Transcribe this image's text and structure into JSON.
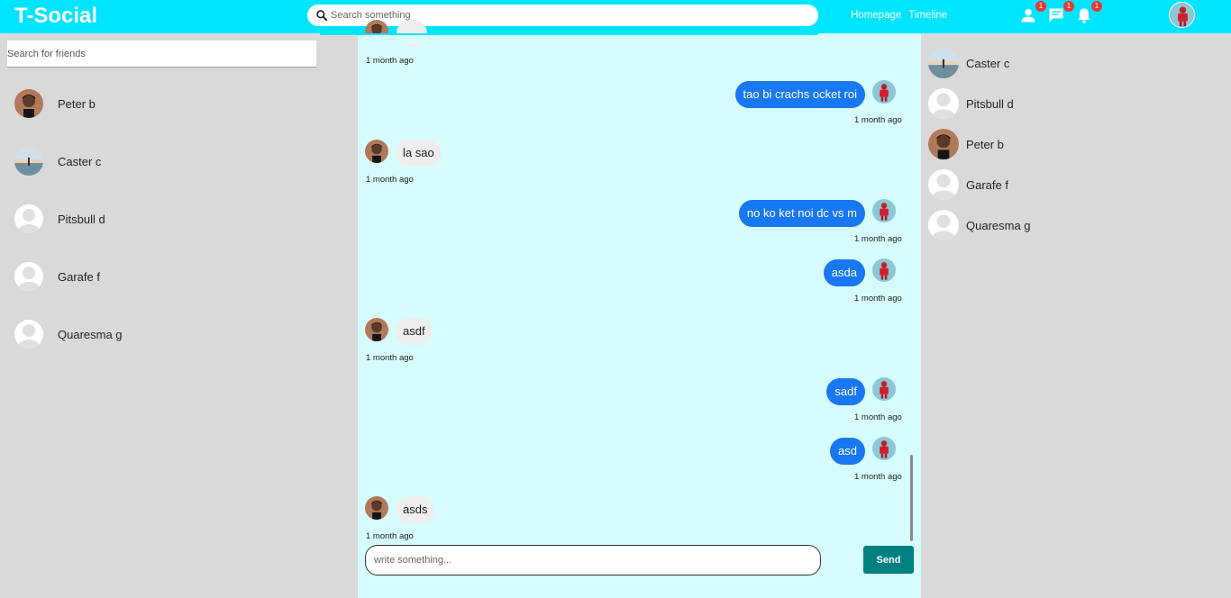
{
  "app": {
    "title": "T-Social"
  },
  "search": {
    "placeholder": "Search something"
  },
  "nav": {
    "homepage": "Homepage",
    "timeline": "Timeline"
  },
  "notifications": {
    "friends": "1",
    "messages": "1",
    "alerts": "1"
  },
  "left_sidebar": {
    "search_placeholder": "Search for friends",
    "friends": [
      {
        "name": "Peter b",
        "avatar": "photo-man"
      },
      {
        "name": "Caster c",
        "avatar": "photo-landscape"
      },
      {
        "name": "Pitsbull d",
        "avatar": "default"
      },
      {
        "name": "Garafe f",
        "avatar": "default"
      },
      {
        "name": "Quaresma g",
        "avatar": "default"
      }
    ]
  },
  "chat": {
    "messages": [
      {
        "side": "in",
        "text": "",
        "time": "1 month ago"
      },
      {
        "side": "out",
        "text": "tao bi crachs ocket roi",
        "time": "1 month ago"
      },
      {
        "side": "in",
        "text": "la sao",
        "time": "1 month ago"
      },
      {
        "side": "out",
        "text": "no ko ket noi dc vs m",
        "time": "1 month ago"
      },
      {
        "side": "out",
        "text": "asda",
        "time": "1 month ago"
      },
      {
        "side": "in",
        "text": "asdf",
        "time": "1 month ago"
      },
      {
        "side": "out",
        "text": "sadf",
        "time": "1 month ago"
      },
      {
        "side": "out",
        "text": "asd",
        "time": "1 month ago"
      },
      {
        "side": "in",
        "text": "asds",
        "time": "1 month ago"
      }
    ],
    "composer_placeholder": "write something...",
    "send_label": "Send"
  },
  "right_sidebar": {
    "contacts": [
      {
        "name": "Caster c",
        "avatar": "photo-landscape"
      },
      {
        "name": "Pitsbull d",
        "avatar": "default"
      },
      {
        "name": "Peter b",
        "avatar": "photo-man"
      },
      {
        "name": "Garafe f",
        "avatar": "default"
      },
      {
        "name": "Quaresma g",
        "avatar": "default"
      }
    ]
  },
  "colors": {
    "topbar": "#00e5ff",
    "chat_bg": "#d6fcfd",
    "outgoing_bubble": "#1877f2",
    "incoming_bubble": "#eeeeee",
    "send_button": "#008080",
    "badge": "#e53935"
  }
}
